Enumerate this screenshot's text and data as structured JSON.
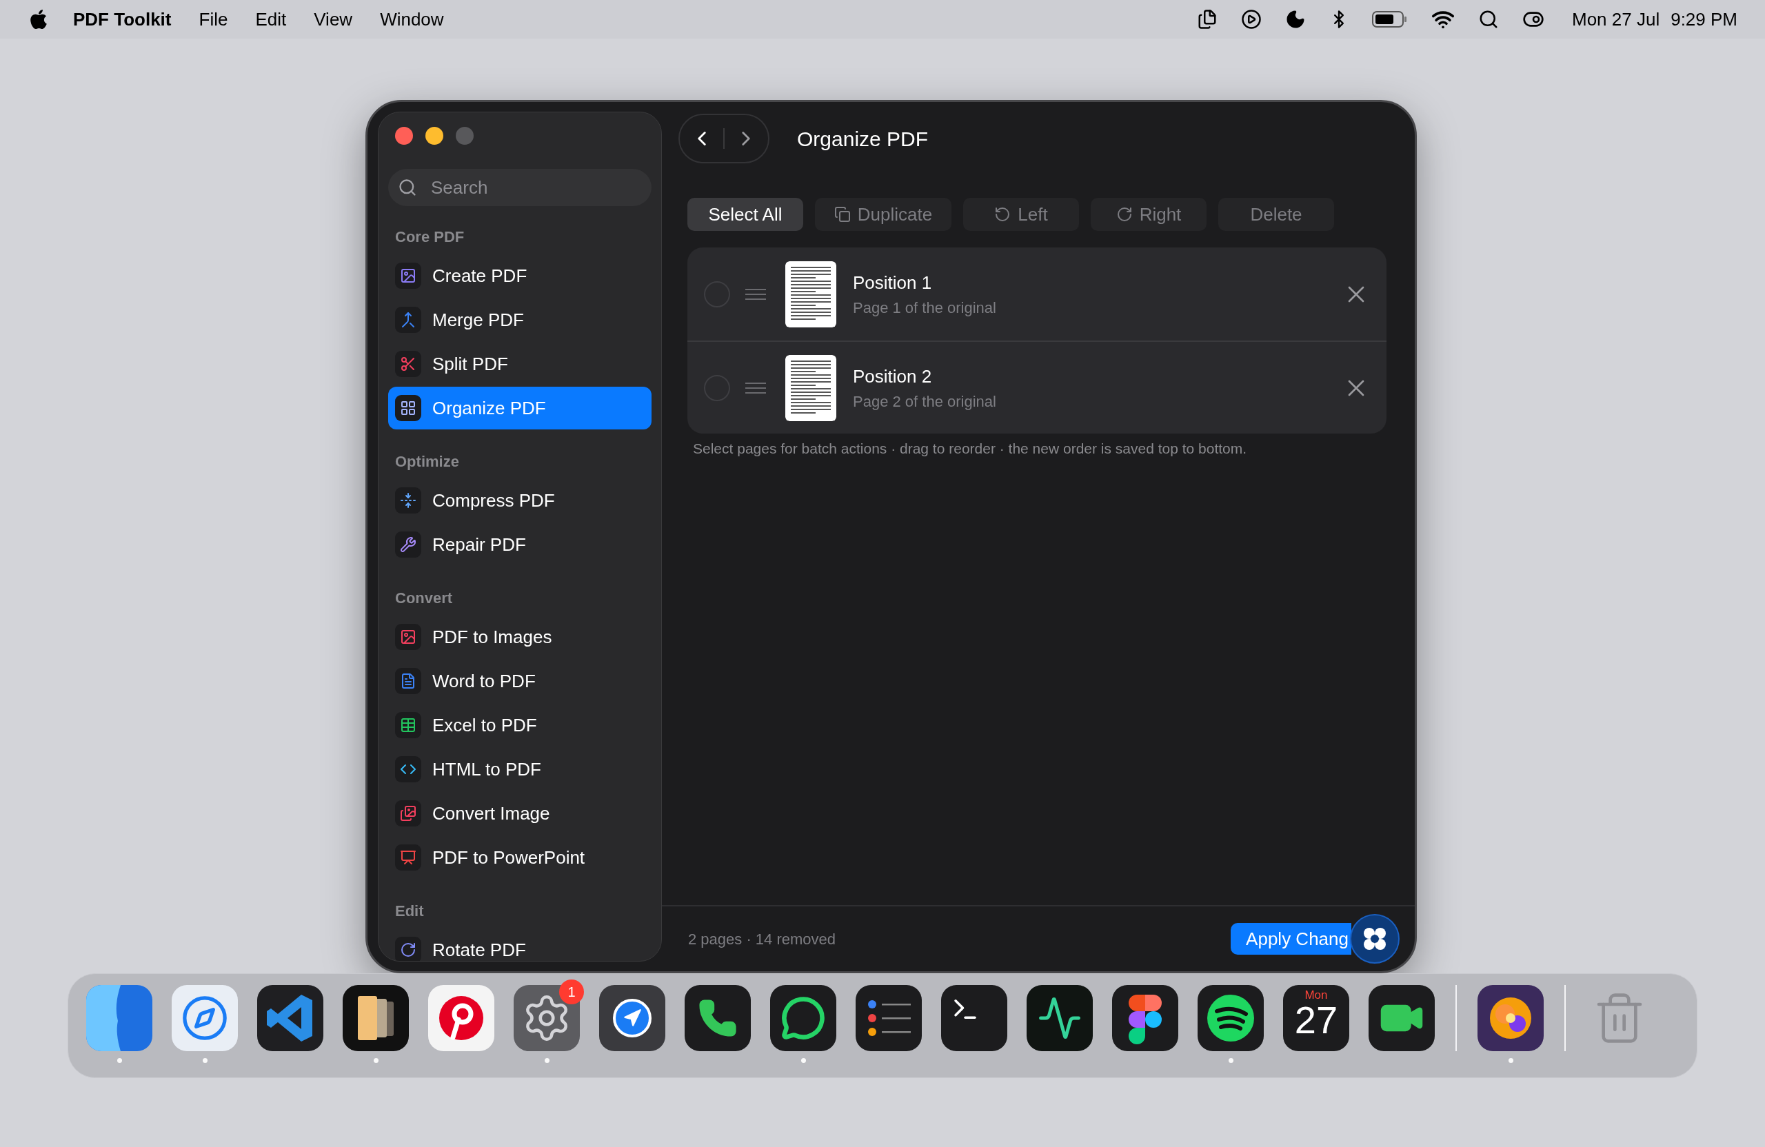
{
  "menu_bar": {
    "app_name": "PDF Toolkit",
    "menus": [
      "File",
      "Edit",
      "View",
      "Window"
    ],
    "date": "Mon 27 Jul",
    "time": "9:29 PM"
  },
  "window": {
    "zoom_enabled": false
  },
  "sidebar": {
    "search": {
      "placeholder": "Search"
    },
    "sections": [
      {
        "title": "Core PDF",
        "items": [
          {
            "label": "Create PDF",
            "selected": false
          },
          {
            "label": "Merge PDF",
            "selected": false
          },
          {
            "label": "Split PDF",
            "selected": false
          },
          {
            "label": "Organize PDF",
            "selected": true
          }
        ]
      },
      {
        "title": "Optimize",
        "items": [
          {
            "label": "Compress PDF",
            "selected": false
          },
          {
            "label": "Repair PDF",
            "selected": false
          }
        ]
      },
      {
        "title": "Convert",
        "items": [
          {
            "label": "PDF to Images",
            "selected": false
          },
          {
            "label": "Word to PDF",
            "selected": false
          },
          {
            "label": "Excel to PDF",
            "selected": false
          },
          {
            "label": "HTML to PDF",
            "selected": false
          },
          {
            "label": "Convert Image",
            "selected": false
          },
          {
            "label": "PDF to PowerPoint",
            "selected": false
          }
        ]
      },
      {
        "title": "Edit",
        "items": [
          {
            "label": "Rotate PDF",
            "selected": false
          }
        ]
      }
    ]
  },
  "title": "Organize PDF",
  "toolbar": [
    {
      "label": "Select All",
      "disabled": false
    },
    {
      "label": "Duplicate",
      "disabled": true
    },
    {
      "label": "Left",
      "disabled": true
    },
    {
      "label": "Right",
      "disabled": true
    },
    {
      "label": "Delete",
      "disabled": true
    }
  ],
  "pages": [
    {
      "title": "Position 1",
      "subtitle": "Page 1 of the original",
      "selected": false
    },
    {
      "title": "Position 2",
      "subtitle": "Page 2 of the original",
      "selected": false
    }
  ],
  "hint": "Select pages for batch actions · drag to reorder · the new order is saved top to bottom.",
  "footer": {
    "summary": "2 pages · 14 removed",
    "apply_button": "Apply Chang"
  },
  "dock": [
    {
      "kind": "finder",
      "running": true
    },
    {
      "kind": "compass",
      "running": true
    },
    {
      "kind": "code",
      "running": false
    },
    {
      "kind": "cards",
      "running": true
    },
    {
      "kind": "pin",
      "running": false
    },
    {
      "kind": "gear",
      "running": true,
      "badge": "1"
    },
    {
      "kind": "navigation",
      "running": false
    },
    {
      "kind": "phone",
      "running": false
    },
    {
      "kind": "chat",
      "running": true
    },
    {
      "kind": "list",
      "running": false
    },
    {
      "kind": "terminal",
      "running": false
    },
    {
      "kind": "pulse",
      "running": false
    },
    {
      "kind": "shapes",
      "running": false
    },
    {
      "kind": "waves",
      "running": true
    },
    {
      "kind": "calendar",
      "running": false,
      "weekday": "Mon",
      "day": "27"
    },
    {
      "kind": "video",
      "running": false
    },
    {
      "kind": "separator"
    },
    {
      "kind": "art",
      "running": true
    },
    {
      "kind": "separator"
    },
    {
      "kind": "trash",
      "running": false
    }
  ]
}
